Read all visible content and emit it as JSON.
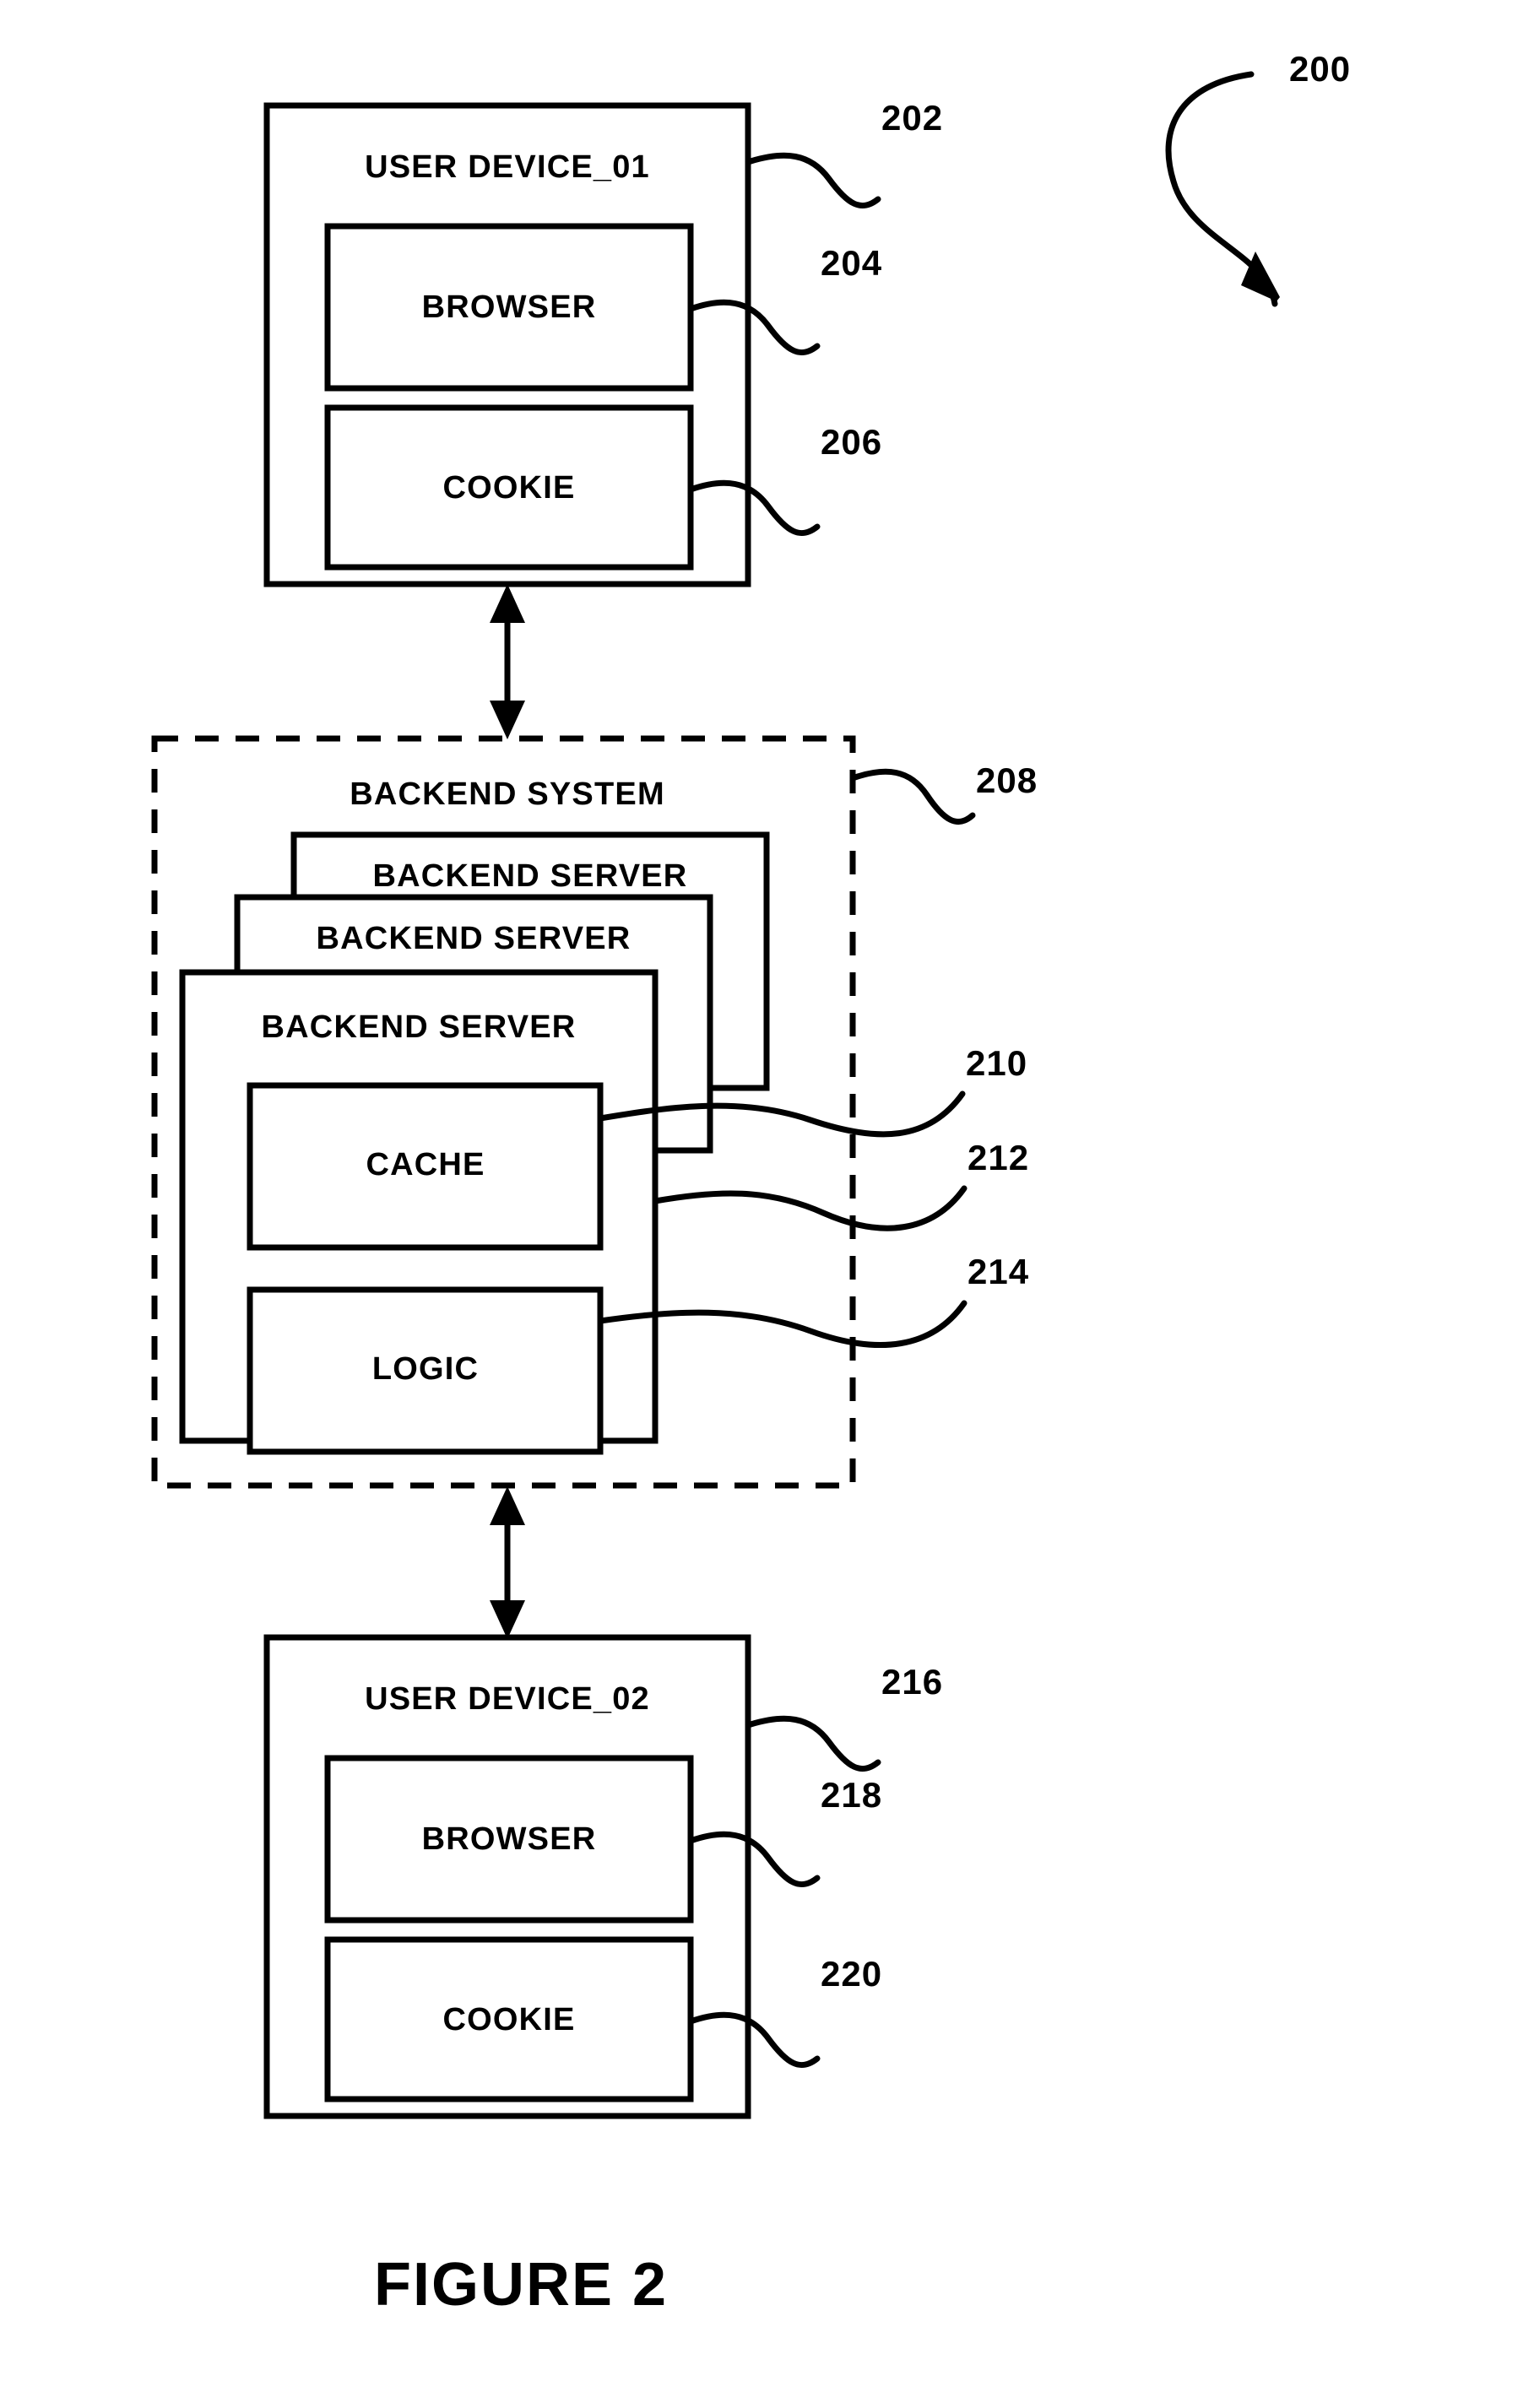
{
  "figure": {
    "caption": "FIGURE 2",
    "system_ref": "200"
  },
  "user_device_01": {
    "title": "USER DEVICE_01",
    "ref": "202",
    "browser": {
      "label": "BROWSER",
      "ref": "204"
    },
    "cookie": {
      "label": "COOKIE",
      "ref": "206"
    }
  },
  "backend_system": {
    "title": "BACKEND SYSTEM",
    "ref": "208",
    "servers": [
      {
        "label": "BACKEND SERVER"
      },
      {
        "label": "BACKEND SERVER"
      },
      {
        "label": "BACKEND SERVER"
      }
    ],
    "cache": {
      "label": "CACHE",
      "ref": "210"
    },
    "server_ref": "212",
    "logic": {
      "label": "LOGIC",
      "ref": "214"
    }
  },
  "user_device_02": {
    "title": "USER DEVICE_02",
    "ref": "216",
    "browser": {
      "label": "BROWSER",
      "ref": "218"
    },
    "cookie": {
      "label": "COOKIE",
      "ref": "220"
    }
  },
  "connectors": {
    "top_link": "bidirectional-arrow",
    "bottom_link": "bidirectional-arrow"
  },
  "colors": {
    "ink": "#000000",
    "paper": "#ffffff"
  }
}
